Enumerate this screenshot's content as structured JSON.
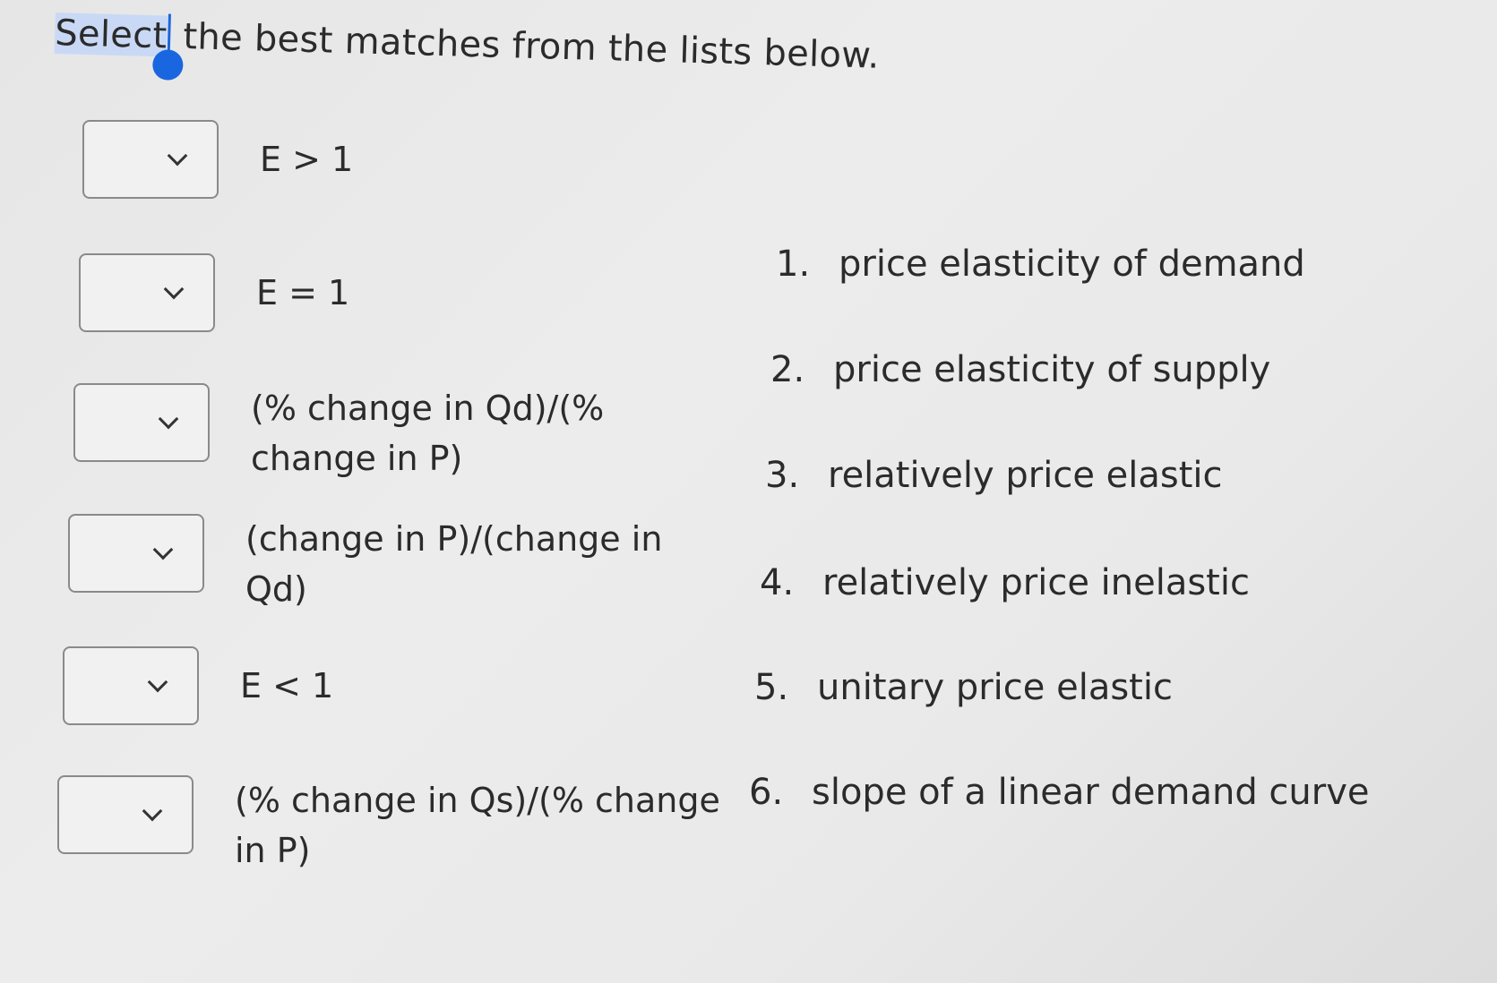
{
  "instruction": {
    "selected_word": "Select",
    "rest": " the best matches from the lists below."
  },
  "matches": [
    {
      "term_lines": [
        "E > 1"
      ],
      "selected": ""
    },
    {
      "term_lines": [
        "E = 1"
      ],
      "selected": ""
    },
    {
      "term_lines": [
        "(% change in Qd)/(%",
        "change in P)"
      ],
      "selected": ""
    },
    {
      "term_lines": [
        "(change in P)/(change in",
        "Qd)"
      ],
      "selected": ""
    },
    {
      "term_lines": [
        "E < 1"
      ],
      "selected": ""
    },
    {
      "term_lines": [
        "(% change in Qs)/(% change",
        "in P)"
      ],
      "selected": ""
    }
  ],
  "options": [
    {
      "number": "1.",
      "label": "price elasticity of demand"
    },
    {
      "number": "2.",
      "label": "price elasticity of supply"
    },
    {
      "number": "3.",
      "label": "relatively price elastic"
    },
    {
      "number": "4.",
      "label": "relatively price inelastic"
    },
    {
      "number": "5.",
      "label": "unitary price elastic"
    },
    {
      "number": "6.",
      "label": "slope of a linear demand curve"
    }
  ]
}
